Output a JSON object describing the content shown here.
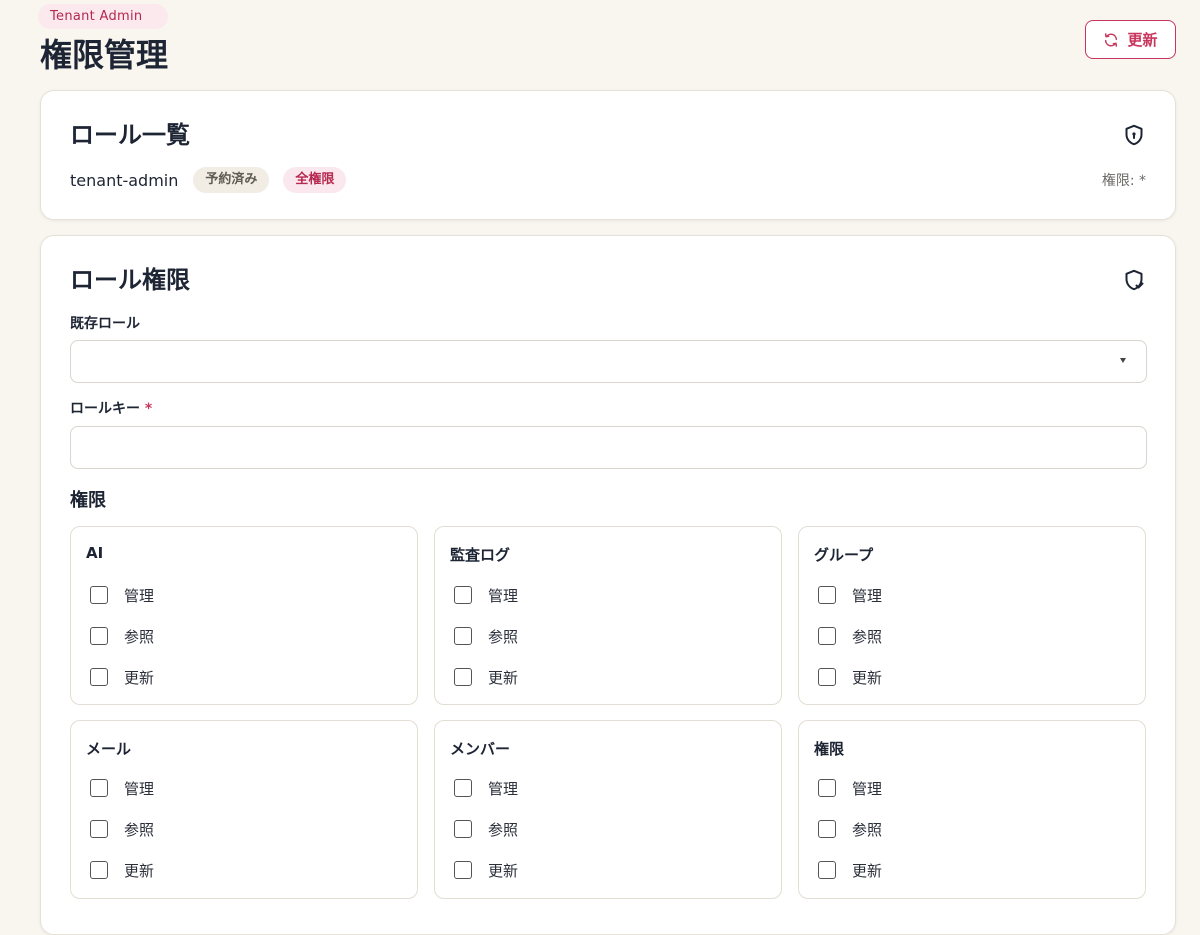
{
  "header": {
    "tenant_label": "Tenant Admin",
    "title": "権限管理",
    "refresh_label": "更新"
  },
  "roles_card": {
    "title": "ロール一覧",
    "roles": [
      {
        "name": "tenant-admin",
        "badges": [
          "予約済み",
          "全権限"
        ],
        "permissions_text": "権限: *"
      }
    ]
  },
  "perm_card": {
    "title": "ロール権限",
    "existing_role_label": "既存ロール",
    "existing_role_value": "",
    "role_key_label": "ロールキー",
    "role_key_required_mark": "*",
    "role_key_value": "",
    "permissions_label": "権限",
    "groups": [
      {
        "title": "AI",
        "options": [
          "管理",
          "参照",
          "更新"
        ]
      },
      {
        "title": "監査ログ",
        "options": [
          "管理",
          "参照",
          "更新"
        ]
      },
      {
        "title": "グループ",
        "options": [
          "管理",
          "参照",
          "更新"
        ]
      },
      {
        "title": "メール",
        "options": [
          "管理",
          "参照",
          "更新"
        ]
      },
      {
        "title": "メンバー",
        "options": [
          "管理",
          "参照",
          "更新"
        ]
      },
      {
        "title": "権限",
        "options": [
          "管理",
          "参照",
          "更新"
        ]
      }
    ]
  },
  "colors": {
    "accent": "#c8365d",
    "background": "#f9f6f0",
    "text": "#1d2433"
  },
  "icons": {
    "refresh": "refresh-icon",
    "roles": "shield-lock-icon",
    "permissions": "shield-check-icon"
  }
}
